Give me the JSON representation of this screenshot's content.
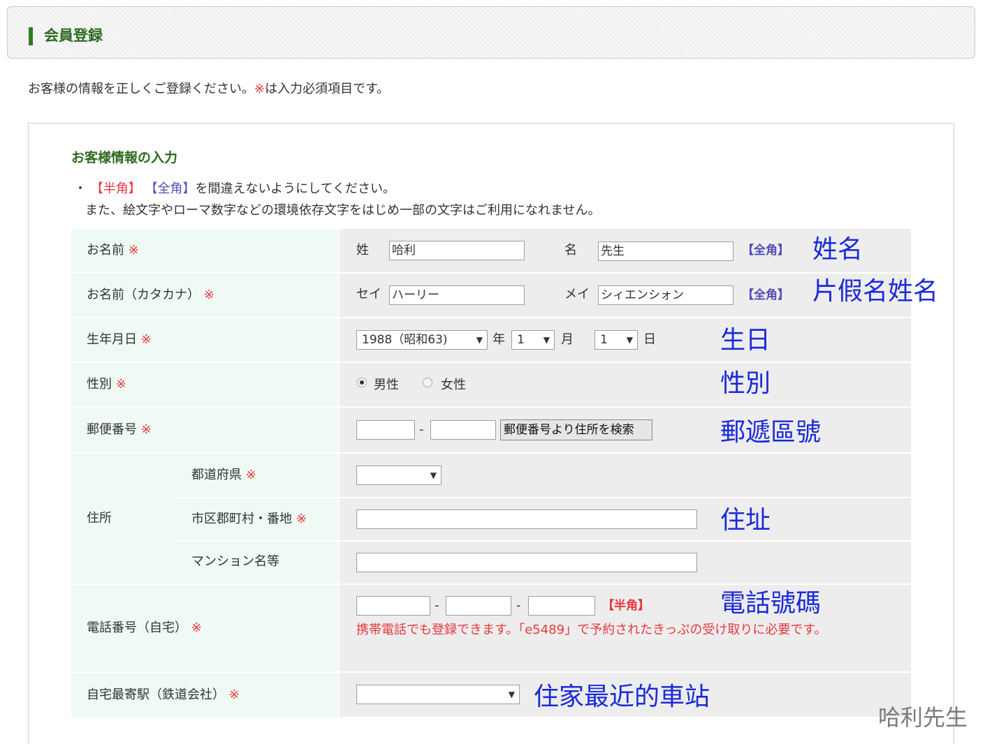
{
  "header": {
    "title": "会員登録"
  },
  "intro": {
    "text": "お客様の情報を正しくご登録ください。",
    "mark": "※",
    "text2": "は入力必須項目です。"
  },
  "section": {
    "title": "お客様情報の入力",
    "bullet": "・",
    "hankaku": "【半角】",
    "zenkaku": "【全角】",
    "note1_rest": "を間違えないようにしてください。",
    "note2": "また、絵文字やローマ数字などの環境依存文字をはじめ一部の文字はご利用になれません。"
  },
  "required_mark": "※",
  "rows": {
    "name": {
      "label": "お名前",
      "sei_label": "姓",
      "sei_value": "哈利",
      "mei_label": "名",
      "mei_value": "先生",
      "tag": "【全角】"
    },
    "kana": {
      "label": "お名前（カタカナ）",
      "sei_label": "セイ",
      "sei_value": "ハーリー",
      "mei_label": "メイ",
      "mei_value": "シィエンシォン",
      "tag": "【全角】"
    },
    "birth": {
      "label": "生年月日",
      "year_value": "1988（昭和63)",
      "year_unit": "年",
      "month_value": "1",
      "month_unit": "月",
      "day_value": "1",
      "day_unit": "日"
    },
    "gender": {
      "label": "性別",
      "male": "男性",
      "female": "女性",
      "selected": "男性"
    },
    "zip": {
      "label": "郵便番号",
      "part1": "",
      "dash": "-",
      "part2": "",
      "search_button": "郵便番号より住所を検索"
    },
    "address": {
      "label": "住所",
      "pref_label": "都道府県",
      "pref_value": "",
      "city_label": "市区郡町村・番地",
      "city_value": "",
      "building_label": "マンション名等",
      "building_value": ""
    },
    "phone": {
      "label": "電話番号（自宅）",
      "part1": "",
      "part2": "",
      "part3": "",
      "dash": "-",
      "tag": "【半角】",
      "note": "携帯電話でも登録できます。「e5489」で予約されたきっぷの受け取りに必要です。"
    },
    "station": {
      "label": "自宅最寄駅（鉄道会社）",
      "value": ""
    }
  },
  "annotations": {
    "name": "姓名",
    "kana": "片假名姓名",
    "birth": "生日",
    "gender": "性別",
    "zip": "郵遞區號",
    "address": "住址",
    "phone": "電話號碼",
    "station": "住家最近的車站"
  },
  "watermark": "哈利先生",
  "colors": {
    "accent_green": "#2e6a1f",
    "required_red": "#e8383d",
    "zenkaku_purple": "#4f4fb8",
    "annotation_blue": "#1a2ad8",
    "label_bg": "#eefaf3",
    "value_bg": "#ededed"
  }
}
